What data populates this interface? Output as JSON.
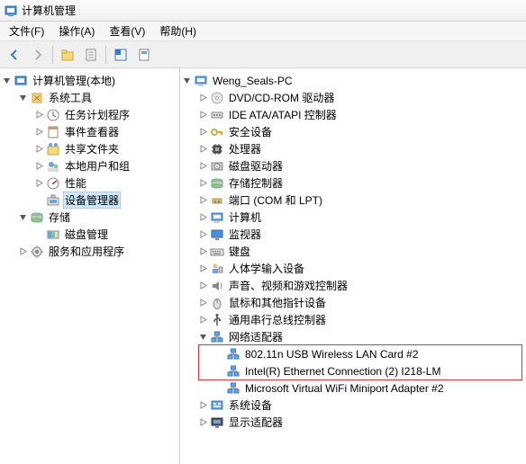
{
  "window": {
    "title": "计算机管理"
  },
  "menu": {
    "file": "文件(F)",
    "action": "操作(A)",
    "view": "查看(V)",
    "help": "帮助(H)"
  },
  "left_tree": {
    "root": "计算机管理(本地)",
    "groups": [
      {
        "label": "系统工具",
        "children": [
          "任务计划程序",
          "事件查看器",
          "共享文件夹",
          "本地用户和组",
          "性能",
          "设备管理器"
        ],
        "selected_index": 5
      },
      {
        "label": "存储",
        "children": [
          "磁盘管理"
        ]
      },
      {
        "label": "服务和应用程序",
        "children": []
      }
    ]
  },
  "right_tree": {
    "root": "Weng_Seals-PC",
    "items": [
      {
        "label": "DVD/CD-ROM 驱动器",
        "icon": "disc"
      },
      {
        "label": "IDE ATA/ATAPI 控制器",
        "icon": "ide"
      },
      {
        "label": "安全设备",
        "icon": "key"
      },
      {
        "label": "处理器",
        "icon": "cpu"
      },
      {
        "label": "磁盘驱动器",
        "icon": "disk"
      },
      {
        "label": "存储控制器",
        "icon": "storage"
      },
      {
        "label": "端口 (COM 和 LPT)",
        "icon": "port"
      },
      {
        "label": "计算机",
        "icon": "computer"
      },
      {
        "label": "监视器",
        "icon": "monitor"
      },
      {
        "label": "键盘",
        "icon": "keyboard"
      },
      {
        "label": "人体学输入设备",
        "icon": "hid"
      },
      {
        "label": "声音、视频和游戏控制器",
        "icon": "sound"
      },
      {
        "label": "鼠标和其他指针设备",
        "icon": "mouse"
      },
      {
        "label": "通用串行总线控制器",
        "icon": "usb"
      },
      {
        "label": "网络适配器",
        "icon": "net",
        "expanded": true,
        "children": [
          "802.11n USB Wireless LAN Card #2",
          "Intel(R) Ethernet Connection (2) I218-LM",
          "Microsoft Virtual WiFi Miniport Adapter #2"
        ],
        "highlight_child_range": [
          0,
          1
        ]
      },
      {
        "label": "系统设备",
        "icon": "system"
      },
      {
        "label": "显示适配器",
        "icon": "display"
      }
    ]
  }
}
